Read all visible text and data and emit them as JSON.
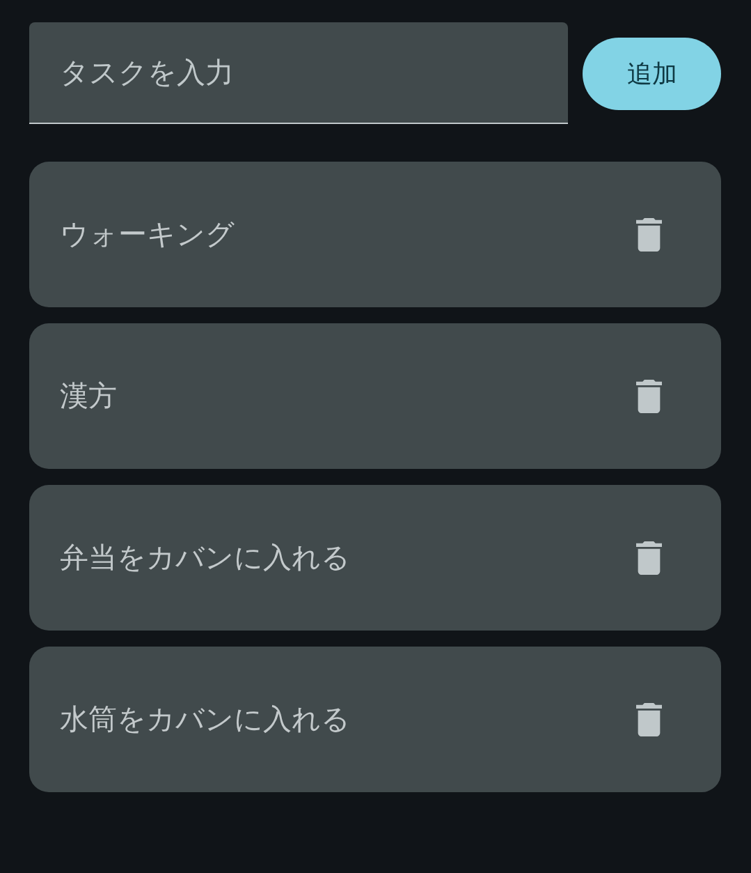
{
  "task_input": {
    "placeholder": "タスクを入力"
  },
  "add_button": {
    "label": "追加"
  },
  "tasks": [
    {
      "text": "ウォーキング"
    },
    {
      "text": "漢方"
    },
    {
      "text": "弁当をカバンに入れる"
    },
    {
      "text": "水筒をカバンに入れる"
    }
  ]
}
